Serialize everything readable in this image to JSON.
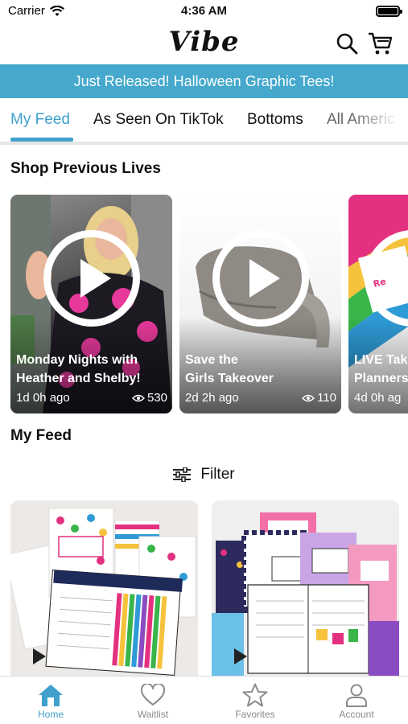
{
  "status_bar": {
    "carrier": "Carrier",
    "time": "4:36 AM"
  },
  "header": {
    "logo": "Vibe"
  },
  "banner": {
    "text": "Just Released! Halloween Graphic Tees!"
  },
  "tabs": [
    {
      "label": "My Feed",
      "active": true
    },
    {
      "label": "As Seen On TikTok",
      "active": false
    },
    {
      "label": "Bottoms",
      "active": false
    },
    {
      "label": "All Americ",
      "active": false
    }
  ],
  "sections": {
    "lives_title": "Shop Previous Lives",
    "feed_title": "My Feed"
  },
  "lives": [
    {
      "title_line1": "Monday Nights with",
      "title_line2": "Heather and Shelby!",
      "ago": "1d 0h ago",
      "views": "530"
    },
    {
      "title_line1": "Save the",
      "title_line2": "Girls Takeover",
      "ago": "2d 2h ago",
      "views": "110"
    },
    {
      "title_line1": "LIVE Tak",
      "title_line2": "Planners",
      "ago": "4d 0h ag",
      "views": ""
    }
  ],
  "filter": {
    "label": "Filter"
  },
  "bottom_nav": [
    {
      "label": "Home",
      "icon": "home-icon",
      "active": true
    },
    {
      "label": "Waitlist",
      "icon": "heart-icon",
      "active": false
    },
    {
      "label": "Favorites",
      "icon": "star-icon",
      "active": false
    },
    {
      "label": "Account",
      "icon": "person-icon",
      "active": false
    }
  ],
  "colors": {
    "accent": "#45a8cc",
    "active_tab": "#3fa0cc",
    "inactive_nav": "#8a8a8a"
  }
}
